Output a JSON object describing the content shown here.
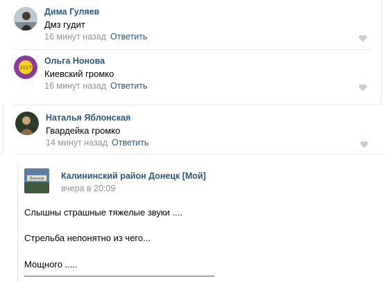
{
  "comments": [
    {
      "author": "Дима Гуляев",
      "text": "Дмз гудит",
      "time": "16 минут назад",
      "reply": "Ответить"
    },
    {
      "author": "Ольга Нонова",
      "text": "Киевский громко",
      "time": "16 минут назад",
      "reply": "Ответить",
      "avatar_badge": "2017"
    },
    {
      "author": "Наталья Яблонская",
      "text": "Гвардейка громко",
      "time": "14 минут назад",
      "reply": "Ответить"
    }
  ],
  "post": {
    "author": "Калининский район Донецк [Мой]",
    "date": "вчера в 20:09",
    "avatar_caption": "Донецк",
    "lines": [
      "Слышны страшные тяжелые звуки ....",
      "Стрельба непонятно из чего...",
      "Мощного ....."
    ]
  },
  "colors": {
    "link": "#2a5885",
    "meta": "#939393",
    "divider": "#e7e8ec",
    "like_icon": "#c5cdd6"
  },
  "icons": [
    "heart-icon"
  ]
}
